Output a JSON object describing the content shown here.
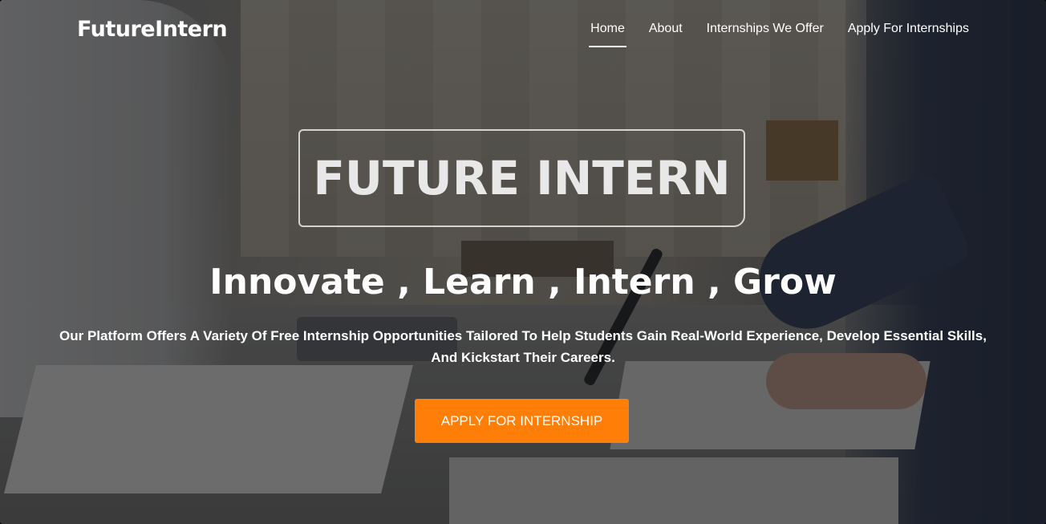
{
  "navbar": {
    "brand": "FutureIntern",
    "links": [
      {
        "label": "Home",
        "active": true
      },
      {
        "label": "About",
        "active": false
      },
      {
        "label": "Internships We Offer",
        "active": false
      },
      {
        "label": "Apply For Internships",
        "active": false
      }
    ]
  },
  "hero": {
    "title": "FUTURE INTERN",
    "tagline": "Innovate , Learn , Intern , Grow",
    "description": "Our Platform Offers A Variety Of Free Internship Opportunities Tailored To Help Students Gain Real-World Experience, Develop Essential Skills, And Kickstart Their Careers.",
    "cta_label": "APPLY FOR INTERNSHIP"
  },
  "colors": {
    "accent": "#ff7e07",
    "overlay": "#14161a",
    "text": "#ffffff"
  }
}
